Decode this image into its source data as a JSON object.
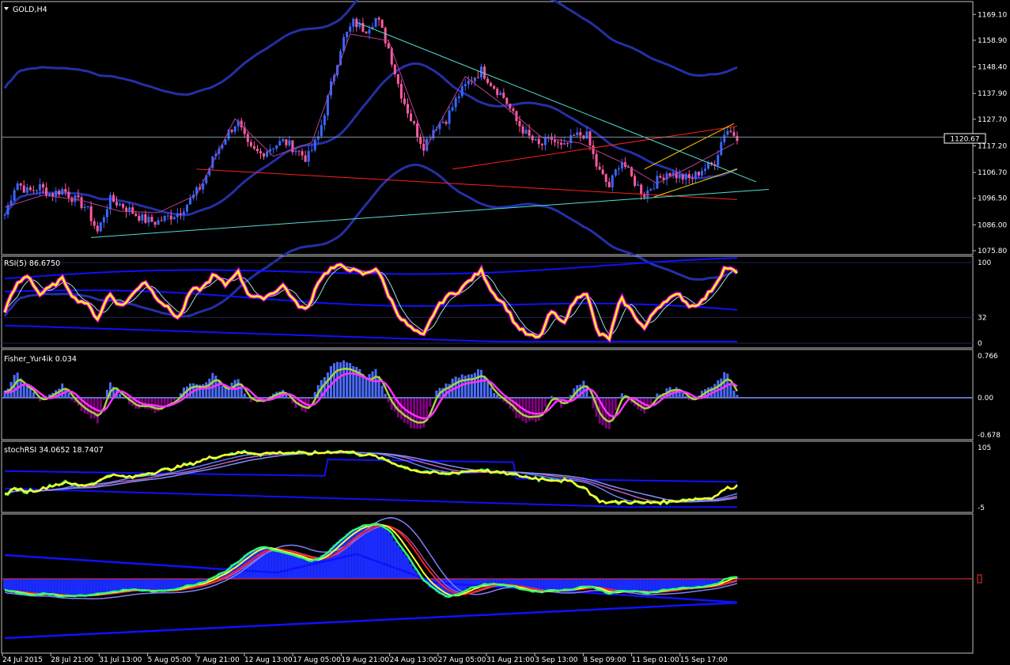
{
  "window": {
    "title": "GOLD,H4"
  },
  "colors": {
    "background": "#000000",
    "frame": "#c0c0c0",
    "bull_candle": "#3a66ff",
    "bear_candle": "#ff5aa0",
    "bands": "#252fa6",
    "trend_red": "#ff2020",
    "trend_cyan": "#4fe0d0",
    "channel_yellow": "#ffd000",
    "rsi_main": "#ffff00",
    "rsi_glow": "#ff00ff",
    "fisher_pos": "#4a6dff",
    "fisher_neg": "#800080",
    "fisher_line": "#a8d040",
    "fisher_signal": "#ff30ff",
    "stoch_main": "#ffff30",
    "stoch_fast": "#30ff60",
    "level_blue": "#1010ff",
    "zero_line": "#ff3030"
  },
  "chart_data": [
    {
      "type": "candlestick",
      "title": "GOLD,H4",
      "ylim": [
        1075.8,
        1172.0
      ],
      "y_ticks": [
        "1169.10",
        "1158.90",
        "1148.40",
        "1137.90",
        "1127.70",
        "1117.20",
        "1106.70",
        "1096.50",
        "1086.00",
        "1075.80"
      ],
      "current_price": "1120.67",
      "x_labels": [
        "24 Jul 2015",
        "28 Jul 21:00",
        "31 Jul 13:00",
        "5 Aug 05:00",
        "7 Aug 21:00",
        "12 Aug 13:00",
        "17 Aug 05:00",
        "19 Aug 21:00",
        "24 Aug 13:00",
        "27 Aug 05:00",
        "31 Aug 21:00",
        "3 Sep 13:00",
        "8 Sep 09:00",
        "11 Sep 01:00",
        "15 Sep 17:00"
      ],
      "close_path": [
        1090,
        1103,
        1099,
        1101,
        1098,
        1100,
        1096,
        1093,
        1083,
        1096,
        1094,
        1091,
        1088,
        1087,
        1089,
        1091,
        1096,
        1102,
        1113,
        1121,
        1127,
        1116,
        1114,
        1117,
        1119,
        1116,
        1112,
        1121,
        1140,
        1158,
        1166,
        1163,
        1168,
        1156,
        1139,
        1127,
        1117,
        1125,
        1128,
        1137,
        1143,
        1147,
        1141,
        1136,
        1127,
        1121,
        1117,
        1120,
        1116,
        1121,
        1122,
        1108,
        1101,
        1112,
        1104,
        1098,
        1103,
        1107,
        1105,
        1104,
        1108,
        1110,
        1124,
        1121
      ]
    },
    {
      "type": "line",
      "title": "RSI(5) 86.6750",
      "ylim": [
        0,
        100
      ],
      "y_ticks": [
        "100",
        "32",
        "0"
      ],
      "levels": [
        0,
        32,
        100
      ],
      "value": 86.675,
      "path": [
        40,
        72,
        85,
        60,
        70,
        80,
        55,
        50,
        30,
        62,
        45,
        60,
        78,
        58,
        44,
        30,
        65,
        68,
        85,
        72,
        90,
        60,
        55,
        62,
        72,
        50,
        40,
        78,
        92,
        96,
        90,
        85,
        94,
        60,
        32,
        18,
        8,
        40,
        58,
        64,
        78,
        90,
        62,
        48,
        22,
        10,
        6,
        40,
        24,
        52,
        66,
        12,
        6,
        56,
        38,
        18,
        42,
        55,
        60,
        45,
        52,
        70,
        95,
        86.675
      ]
    },
    {
      "type": "histogram",
      "title": "Fisher_Yur4ik 0.034",
      "ylim": [
        -0.678,
        0.766
      ],
      "y_ticks": [
        "0.766",
        "0.00",
        "-0.678"
      ],
      "value": 0.034,
      "path": [
        0.1,
        0.45,
        0.2,
        -0.05,
        0.05,
        0.25,
        -0.1,
        -0.3,
        -0.45,
        0.3,
        0.05,
        -0.15,
        -0.2,
        -0.25,
        -0.15,
        0.05,
        0.3,
        0.25,
        0.45,
        0.15,
        0.35,
        -0.05,
        -0.1,
        0.05,
        0.15,
        -0.15,
        -0.25,
        0.25,
        0.55,
        0.7,
        0.6,
        0.4,
        0.5,
        -0.1,
        -0.4,
        -0.55,
        -0.6,
        0.1,
        0.25,
        0.4,
        0.45,
        0.5,
        0.1,
        -0.1,
        -0.35,
        -0.45,
        -0.4,
        0.05,
        -0.2,
        0.2,
        0.3,
        -0.45,
        -0.55,
        0.1,
        -0.1,
        -0.3,
        0.05,
        0.15,
        0.2,
        -0.05,
        0.1,
        0.2,
        0.5,
        0.034
      ]
    },
    {
      "type": "line",
      "title": "stochRSI 34.0652 18.7407",
      "ylim": [
        -5,
        105
      ],
      "y_ticks": [
        "105",
        "-5"
      ],
      "values": [
        34.0652,
        18.7407
      ],
      "path": [
        20,
        30,
        25,
        28,
        35,
        40,
        38,
        36,
        42,
        55,
        52,
        50,
        58,
        60,
        65,
        70,
        75,
        82,
        88,
        92,
        95,
        96,
        94,
        95,
        96,
        95,
        94,
        95,
        97,
        98,
        96,
        92,
        88,
        80,
        72,
        65,
        60,
        58,
        56,
        60,
        62,
        64,
        60,
        58,
        55,
        50,
        48,
        46,
        45,
        40,
        30,
        8,
        4,
        6,
        5,
        4,
        5,
        6,
        8,
        10,
        12,
        14,
        30,
        34.0652
      ]
    },
    {
      "type": "area",
      "title": "",
      "y_ticks": [],
      "zero_marker": "0",
      "path": [
        -20,
        -25,
        -28,
        -24,
        -26,
        -30,
        -28,
        -27,
        -25,
        -22,
        -20,
        -18,
        -20,
        -22,
        -18,
        -15,
        -10,
        -5,
        5,
        15,
        30,
        45,
        55,
        48,
        42,
        38,
        30,
        35,
        50,
        70,
        85,
        90,
        95,
        80,
        55,
        25,
        -5,
        -20,
        -30,
        -25,
        -15,
        -10,
        -8,
        -12,
        -15,
        -20,
        -22,
        -18,
        -20,
        -15,
        -12,
        -18,
        -25,
        -20,
        -22,
        -24,
        -20,
        -18,
        -16,
        -15,
        -12,
        -10,
        0,
        5
      ]
    }
  ]
}
